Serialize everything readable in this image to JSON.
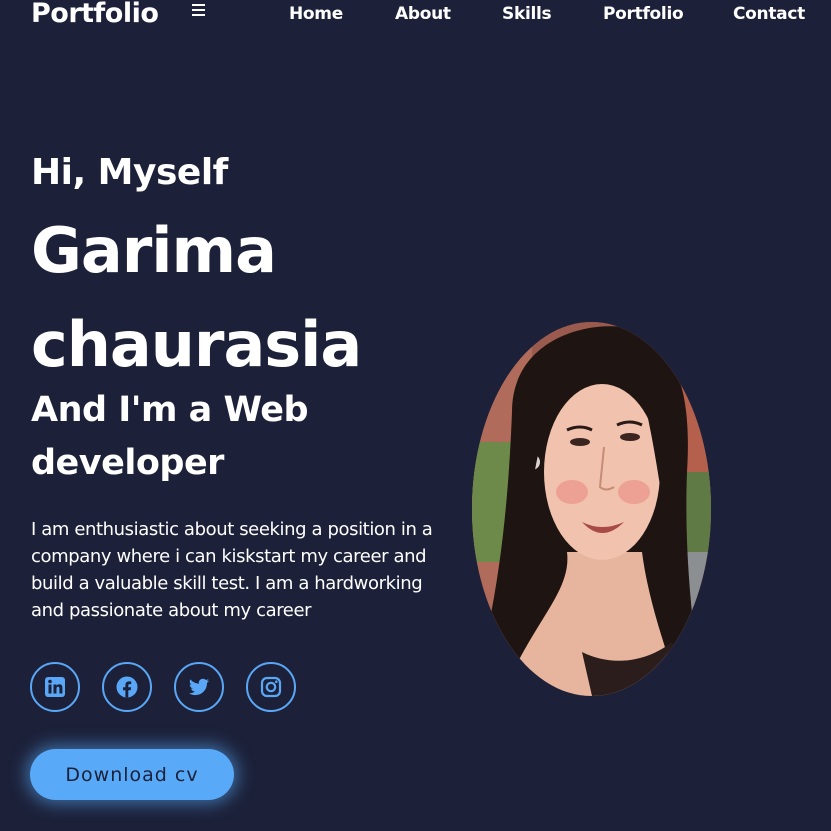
{
  "header": {
    "logo": "Portfolio",
    "menu_icon": "hamburger-menu-icon",
    "nav": [
      "Home",
      "About",
      "Skills",
      "Portfolio",
      "Contact"
    ]
  },
  "hero": {
    "greeting": "Hi, Myself",
    "name": "Garima chaurasia",
    "role": "And I'm a Web developer",
    "bio": "I am enthusiastic about seeking a position in a company where i can kiskstart my career and build a valuable skill test. I am a hardworking and passionate about my career",
    "socials": [
      "linkedin-icon",
      "facebook-icon",
      "twitter-icon",
      "instagram-icon"
    ],
    "download_label": "Download cv"
  },
  "colors": {
    "background": "#1c2139",
    "accent": "#58a9f7",
    "text": "#ffffff"
  }
}
